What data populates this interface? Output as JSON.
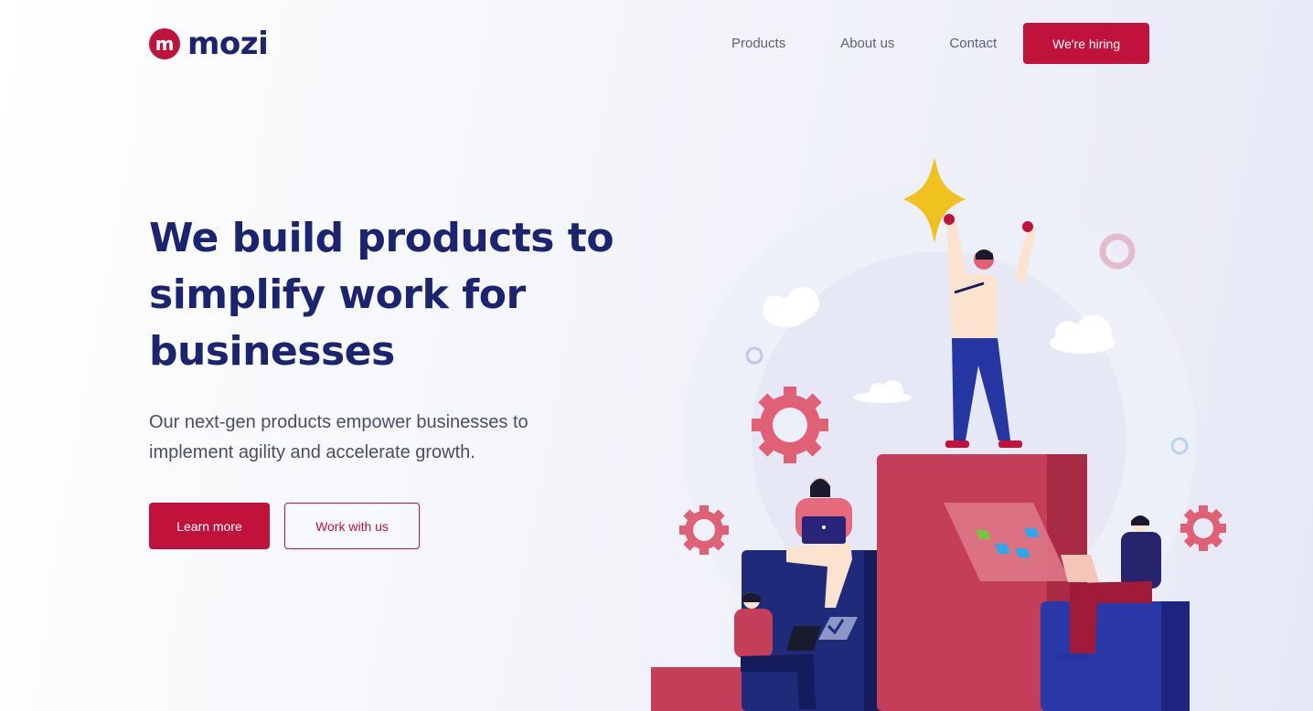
{
  "brand": {
    "logo_letter": "m",
    "name": "mozi",
    "color": "#c1123b",
    "text_color": "#1b2470"
  },
  "nav": {
    "items": [
      {
        "label": "Products"
      },
      {
        "label": "About us"
      },
      {
        "label": "Contact"
      }
    ],
    "cta_label": "We're hiring"
  },
  "hero": {
    "title": "We build products to simplify work for businesses",
    "subtitle": "Our next-gen products empower businesses to implement agility and accelerate growth.",
    "primary_button": "Learn more",
    "secondary_button": "Work with us"
  },
  "illustration": {
    "icons": [
      "star-icon",
      "gear-icon",
      "cloud-icon",
      "ring-icon",
      "laptop-icon",
      "kanban-board-icon"
    ]
  }
}
